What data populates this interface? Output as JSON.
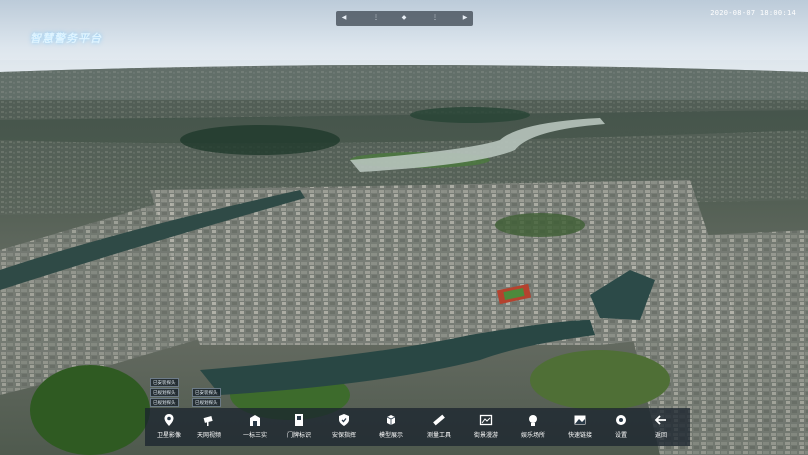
{
  "app": {
    "title": "智慧警务平台"
  },
  "status": {
    "datetime": "2020-08-07 18:00:14"
  },
  "legend": {
    "items": [
      "已安装探头",
      "已规划探头",
      "已安装探头",
      "已规划探头",
      "已规划探头",
      "已规划探头"
    ]
  },
  "toolbar": {
    "items": [
      {
        "label": "卫星影像",
        "icon": "location-pin-icon"
      },
      {
        "label": "天网视频",
        "icon": "camera-icon"
      },
      {
        "label": "一标三实",
        "icon": "building-icon"
      },
      {
        "label": "门牌标识",
        "icon": "doorplate-icon"
      },
      {
        "label": "安保指挥",
        "icon": "shield-icon"
      },
      {
        "label": "模型展示",
        "icon": "model-icon"
      },
      {
        "label": "测量工具",
        "icon": "ruler-icon"
      },
      {
        "label": "街景漫游",
        "icon": "street-view-icon"
      },
      {
        "label": "娱乐场所",
        "icon": "entertainment-icon"
      },
      {
        "label": "快速链接",
        "icon": "image-icon"
      },
      {
        "label": "设置",
        "icon": "gear-icon"
      },
      {
        "label": "返回",
        "icon": "back-arrow-icon"
      }
    ]
  },
  "colors": {
    "sky_top": "#cfdbe6",
    "river": "#2b4f4c",
    "accent_title": "#dff4ff"
  }
}
